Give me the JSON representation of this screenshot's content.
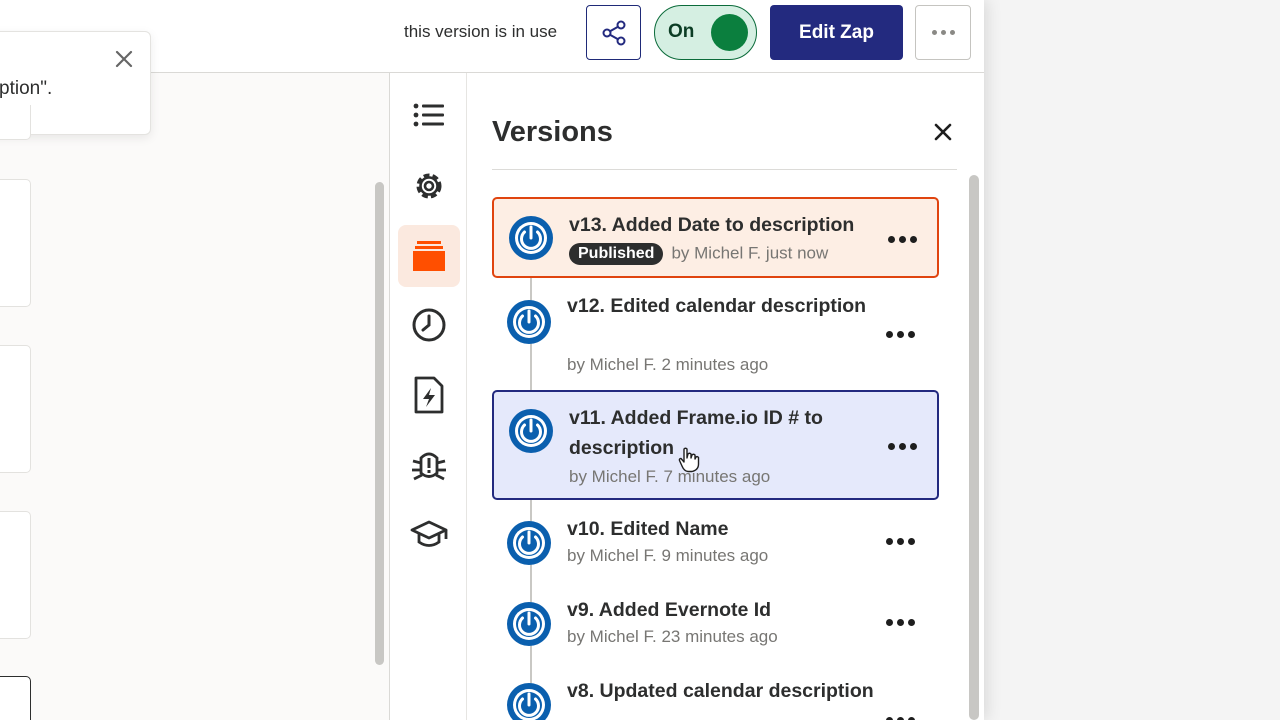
{
  "topbar": {
    "status_text": "this version is in use",
    "toggle_label": "On",
    "edit_label": "Edit Zap",
    "share_icon": "share-nodes-icon",
    "more_icon": "more-horizontal-icon"
  },
  "toast": {
    "text": "ption\"."
  },
  "rail": {
    "items": [
      {
        "icon": "outline-list-icon"
      },
      {
        "icon": "settings-gear-icon"
      },
      {
        "icon": "versions-stack-icon",
        "active": true
      },
      {
        "icon": "history-clock-icon"
      },
      {
        "icon": "zap-file-icon"
      },
      {
        "icon": "bug-alert-icon"
      },
      {
        "icon": "learn-graduation-cap-icon"
      }
    ]
  },
  "versions_panel": {
    "title": "Versions",
    "versions": [
      {
        "title": "v13. Added Date to description",
        "badge": "Published",
        "meta": "by Michel F. just now"
      },
      {
        "title": "v12. Edited calendar description",
        "meta": "by Michel F. 2 minutes ago"
      },
      {
        "title": "v11. Added Frame.io ID # to description",
        "meta": "by Michel F. 7 minutes ago"
      },
      {
        "title": "v10. Edited Name",
        "meta": "by Michel F. 9 minutes ago"
      },
      {
        "title": "v9. Added Evernote Id",
        "meta": "by Michel F. 23 minutes ago"
      },
      {
        "title": "v8. Updated calendar description",
        "meta": ""
      }
    ]
  },
  "colors": {
    "brand_navy": "#232a7f",
    "accent_orange": "#ff4f00",
    "published_border": "#e0440f",
    "toggle_green": "#0b7f3e",
    "version_icon_blue": "#0a5fae"
  }
}
